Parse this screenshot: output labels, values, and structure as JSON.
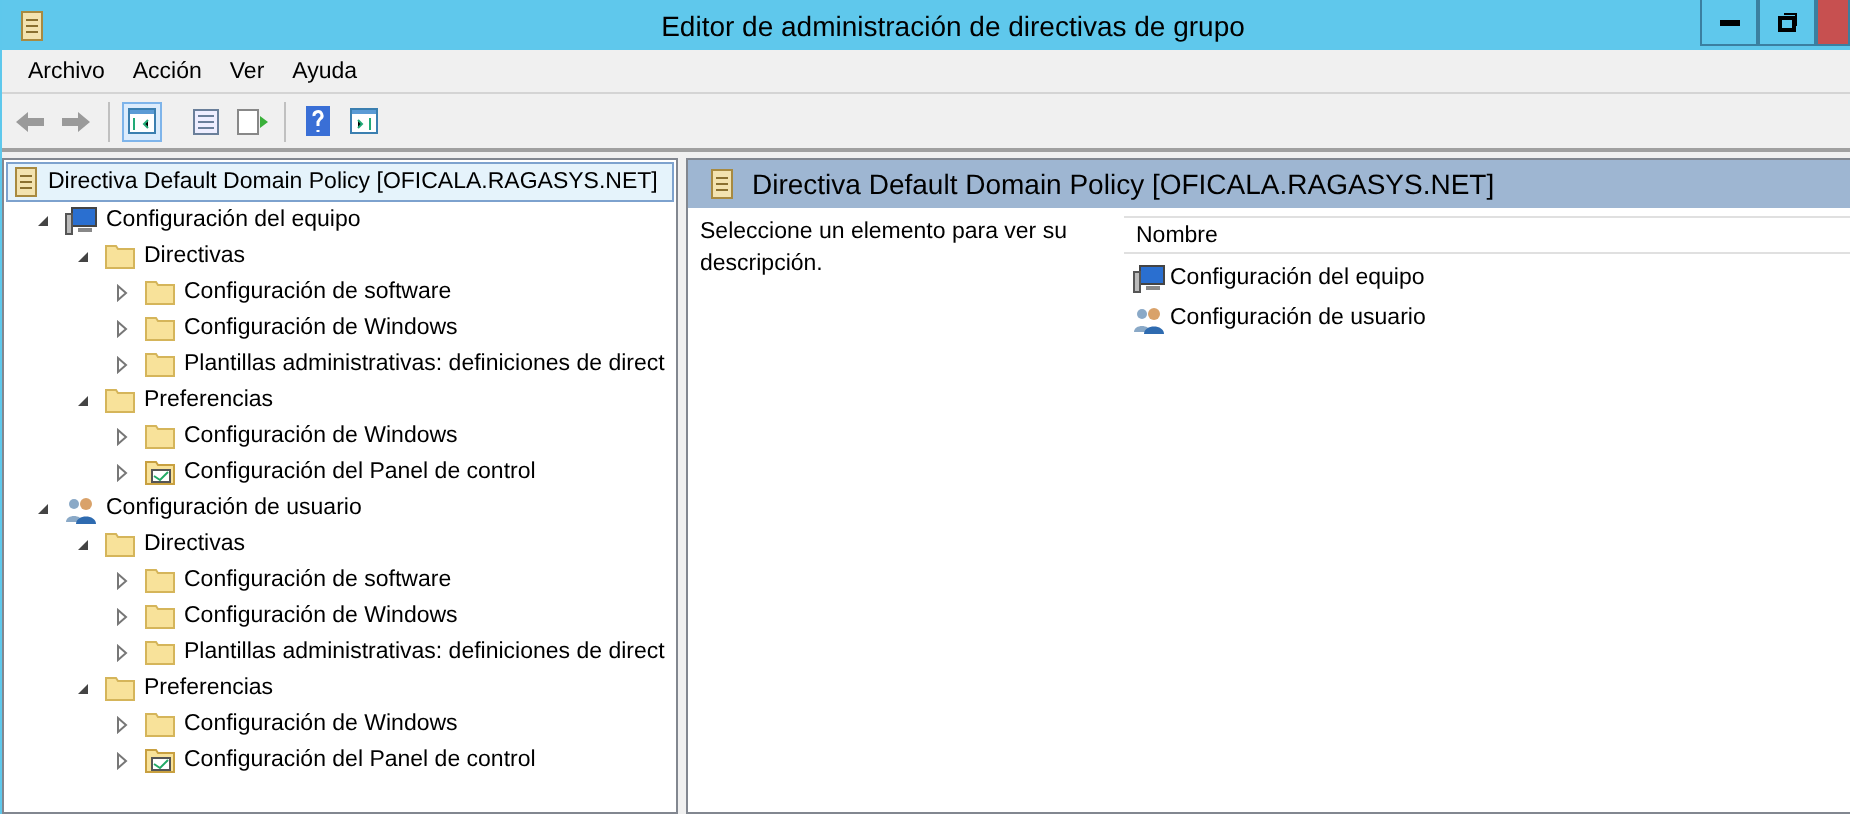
{
  "window": {
    "title": "Editor de administración de directivas de grupo"
  },
  "menu": [
    "Archivo",
    "Acción",
    "Ver",
    "Ayuda"
  ],
  "toolbar": [
    {
      "kind": "back",
      "disabled": true
    },
    {
      "kind": "forward",
      "disabled": true
    },
    {
      "kind": "sep"
    },
    {
      "kind": "tree",
      "selected": true
    },
    {
      "kind": "sep0"
    },
    {
      "kind": "props",
      "selected": false
    },
    {
      "kind": "export",
      "selected": false
    },
    {
      "kind": "sep"
    },
    {
      "kind": "help",
      "selected": false
    },
    {
      "kind": "view",
      "selected": false
    }
  ],
  "tree": {
    "label": "Directiva Default Domain Policy [OFICALA.RAGASYS.NET]",
    "kind": "policy",
    "selected": true,
    "children": [
      {
        "label": "Configuración del equipo",
        "kind": "computer",
        "expanded": true,
        "children": [
          {
            "label": "Directivas",
            "kind": "folder",
            "expanded": true,
            "children": [
              {
                "label": "Configuración de software",
                "kind": "folder",
                "expanded": false
              },
              {
                "label": "Configuración de Windows",
                "kind": "folder",
                "expanded": false
              },
              {
                "label": "Plantillas administrativas: definiciones de direct",
                "kind": "folder",
                "expanded": false
              }
            ]
          },
          {
            "label": "Preferencias",
            "kind": "folder",
            "expanded": true,
            "children": [
              {
                "label": "Configuración de Windows",
                "kind": "folder",
                "expanded": false
              },
              {
                "label": "Configuración del Panel de control",
                "kind": "panel",
                "expanded": false
              }
            ]
          }
        ]
      },
      {
        "label": "Configuración de usuario",
        "kind": "user",
        "expanded": true,
        "children": [
          {
            "label": "Directivas",
            "kind": "folder",
            "expanded": true,
            "children": [
              {
                "label": "Configuración de software",
                "kind": "folder",
                "expanded": false
              },
              {
                "label": "Configuración de Windows",
                "kind": "folder",
                "expanded": false
              },
              {
                "label": "Plantillas administrativas: definiciones de direct",
                "kind": "folder",
                "expanded": false
              }
            ]
          },
          {
            "label": "Preferencias",
            "kind": "folder",
            "expanded": true,
            "children": [
              {
                "label": "Configuración de Windows",
                "kind": "folder",
                "expanded": false
              },
              {
                "label": "Configuración del Panel de control",
                "kind": "panel",
                "expanded": false
              }
            ]
          }
        ]
      }
    ]
  },
  "detail": {
    "title": "Directiva Default Domain Policy [OFICALA.RAGASYS.NET]",
    "description": "Seleccione un elemento para ver su descripción.",
    "column": "Nombre",
    "items": [
      {
        "label": "Configuración del equipo",
        "kind": "computer"
      },
      {
        "label": "Configuración de usuario",
        "kind": "user"
      }
    ]
  }
}
